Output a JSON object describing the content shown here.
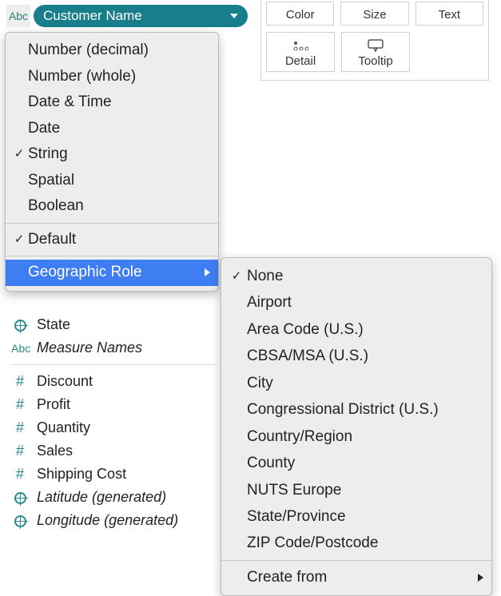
{
  "pill": {
    "type_abbrev": "Abc",
    "field_name": "Customer Name"
  },
  "marks": {
    "row1": [
      {
        "label": "Color"
      },
      {
        "label": "Size"
      },
      {
        "label": "Text"
      }
    ],
    "row2": [
      {
        "label": "Detail"
      },
      {
        "label": "Tooltip"
      }
    ]
  },
  "type_menu": {
    "items": [
      {
        "label": "Number (decimal)",
        "checked": false
      },
      {
        "label": "Number (whole)",
        "checked": false
      },
      {
        "label": "Date & Time",
        "checked": false
      },
      {
        "label": "Date",
        "checked": false
      },
      {
        "label": "String",
        "checked": true
      },
      {
        "label": "Spatial",
        "checked": false
      },
      {
        "label": "Boolean",
        "checked": false
      }
    ],
    "default_label": "Default",
    "default_checked": true,
    "geo_label": "Geographic Role"
  },
  "geo_menu": {
    "items": [
      {
        "label": "None",
        "checked": true
      },
      {
        "label": "Airport"
      },
      {
        "label": "Area Code (U.S.)"
      },
      {
        "label": "CBSA/MSA (U.S.)"
      },
      {
        "label": "City"
      },
      {
        "label": "Congressional District (U.S.)"
      },
      {
        "label": "Country/Region"
      },
      {
        "label": "County"
      },
      {
        "label": "NUTS Europe"
      },
      {
        "label": "State/Province"
      },
      {
        "label": "ZIP Code/Postcode"
      }
    ],
    "create_from": "Create from"
  },
  "fields": [
    {
      "icon": "globe",
      "label": "State",
      "italic": false
    },
    {
      "icon": "abc",
      "label": "Measure Names",
      "italic": true
    },
    {
      "sep": true
    },
    {
      "icon": "hash",
      "label": "Discount"
    },
    {
      "icon": "hash",
      "label": "Profit"
    },
    {
      "icon": "hash",
      "label": "Quantity"
    },
    {
      "icon": "hash",
      "label": "Sales"
    },
    {
      "icon": "hash",
      "label": "Shipping Cost"
    },
    {
      "icon": "globe",
      "label": "Latitude (generated)",
      "italic": true
    },
    {
      "icon": "globe",
      "label": "Longitude (generated)",
      "italic": true
    }
  ]
}
